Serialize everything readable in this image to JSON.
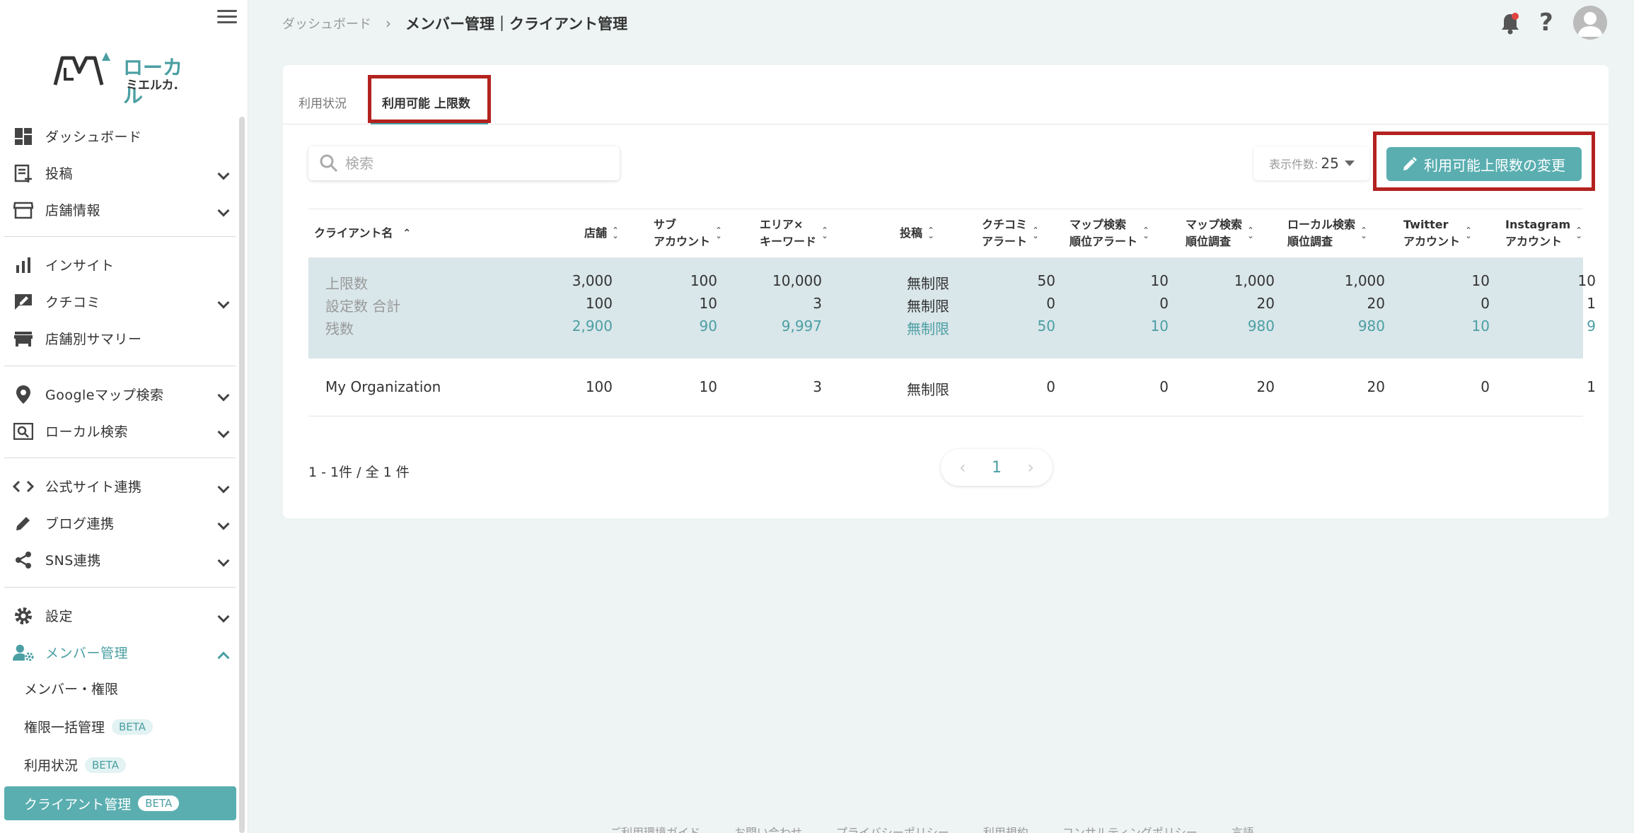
{
  "logo": {
    "line1": "ローカル",
    "line2": "ミエルカ."
  },
  "sidebar": {
    "items": [
      {
        "label": "ダッシュボード"
      },
      {
        "label": "投稿"
      },
      {
        "label": "店舗情報"
      },
      {
        "label": "インサイト"
      },
      {
        "label": "クチコミ"
      },
      {
        "label": "店舗別サマリー"
      },
      {
        "label": "Googleマップ検索"
      },
      {
        "label": "ローカル検索"
      },
      {
        "label": "公式サイト連携"
      },
      {
        "label": "ブログ連携"
      },
      {
        "label": "SNS連携"
      },
      {
        "label": "設定"
      },
      {
        "label": "メンバー管理"
      }
    ],
    "sub_items": [
      {
        "label": "メンバー・権限"
      },
      {
        "label": "権限一括管理",
        "badge": "BETA"
      },
      {
        "label": "利用状況",
        "badge": "BETA"
      },
      {
        "label": "クライアント管理",
        "badge": "BETA"
      }
    ]
  },
  "header": {
    "crumb_home": "ダッシュボード",
    "crumb_sep": "›",
    "crumb_current": "メンバー管理｜クライアント管理",
    "help": "?"
  },
  "tabs": [
    {
      "label": "利用状況"
    },
    {
      "label": "利用可能 上限数"
    }
  ],
  "search": {
    "placeholder": "検索"
  },
  "perpage": {
    "label": "表示件数:",
    "value": "25"
  },
  "change_button": "利用可能上限数の変更",
  "table": {
    "columns": [
      {
        "line1": "クライアント名",
        "line2": ""
      },
      {
        "line1": "店舗",
        "line2": ""
      },
      {
        "line1": "サブ",
        "line2": "アカウント"
      },
      {
        "line1": "エリア×",
        "line2": "キーワード"
      },
      {
        "line1": "投稿",
        "line2": ""
      },
      {
        "line1": "クチコミ",
        "line2": "アラート"
      },
      {
        "line1": "マップ検索",
        "line2": "順位アラート"
      },
      {
        "line1": "マップ検索",
        "line2": "順位調査"
      },
      {
        "line1": "ローカル検索",
        "line2": "順位調査"
      },
      {
        "line1": "Twitter",
        "line2": "アカウント"
      },
      {
        "line1": "Instagram",
        "line2": "アカウント"
      }
    ],
    "summary": [
      {
        "label": "上限数",
        "values": [
          "3,000",
          "100",
          "10,000",
          "無制限",
          "50",
          "10",
          "1,000",
          "1,000",
          "10",
          "10"
        ]
      },
      {
        "label": "設定数 合計",
        "values": [
          "100",
          "10",
          "3",
          "無制限",
          "0",
          "0",
          "20",
          "20",
          "0",
          "1"
        ]
      },
      {
        "label": "残数",
        "values": [
          "2,900",
          "90",
          "9,997",
          "無制限",
          "50",
          "10",
          "980",
          "980",
          "10",
          "9"
        ]
      }
    ],
    "rows": [
      {
        "name": "My Organization",
        "values": [
          "100",
          "10",
          "3",
          "無制限",
          "0",
          "0",
          "20",
          "20",
          "0",
          "1"
        ]
      }
    ]
  },
  "pager": {
    "info": "1 - 1件 / 全 1 件",
    "page": "1",
    "prev": "‹",
    "next": "›"
  },
  "footer": [
    "ご利用環境ガイド",
    "お問い合わせ",
    "プライバシーポリシー",
    "利用規約",
    "コンサルティングポリシー",
    "言語"
  ]
}
